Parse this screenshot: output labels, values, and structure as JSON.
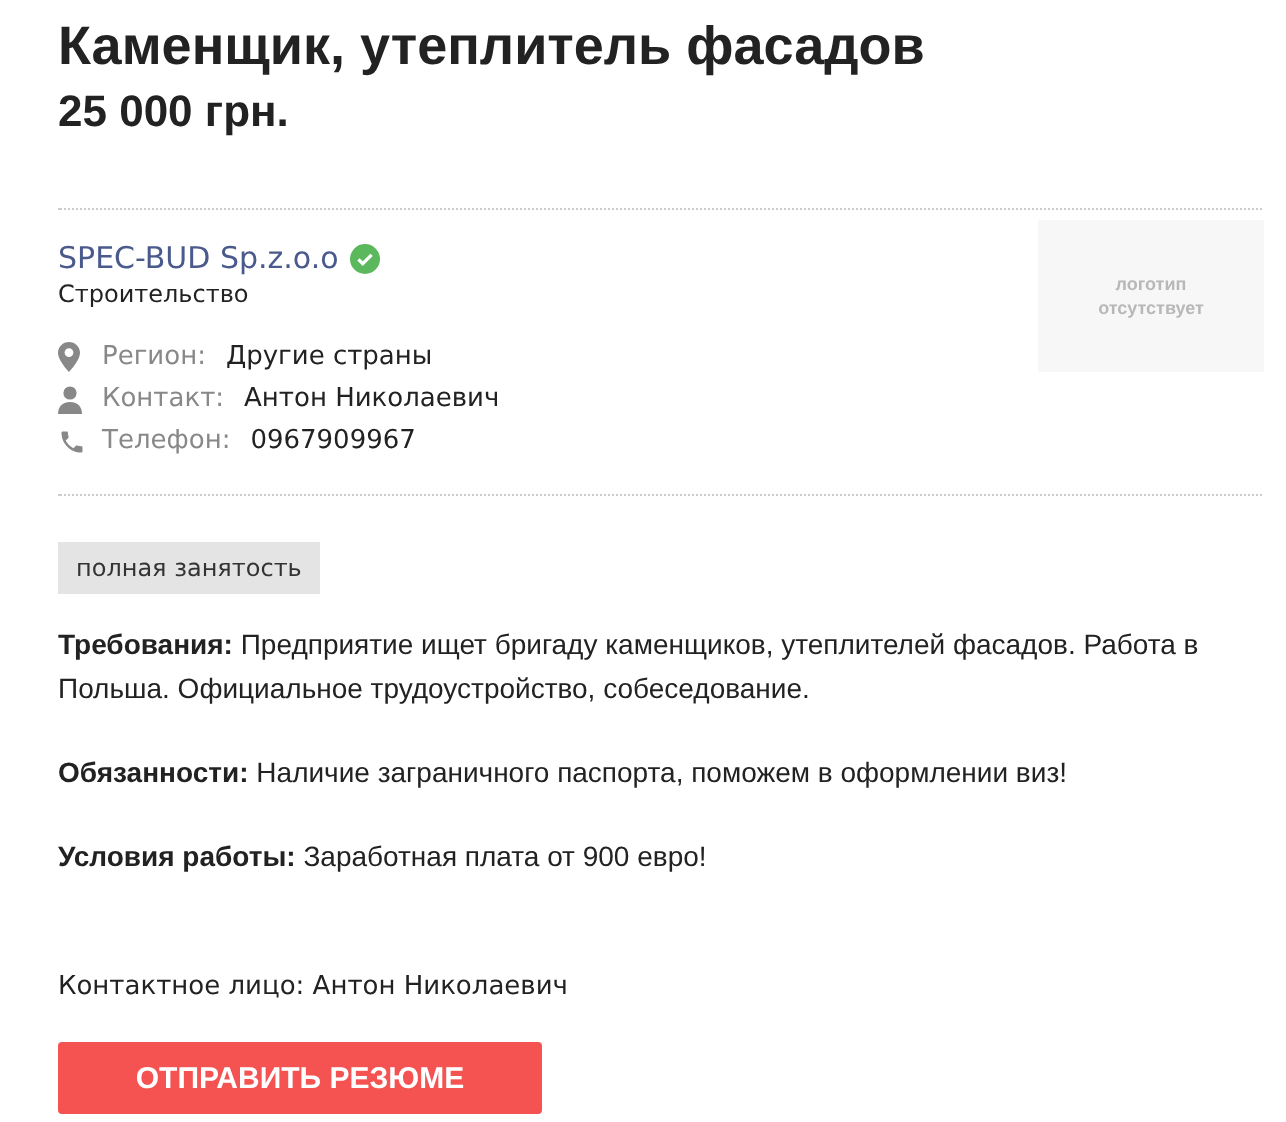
{
  "title": "Каменщик, утеплитель фасадов",
  "salary": "25 000 грн.",
  "company": {
    "name": "SPEC-BUD Sp.z.o.o",
    "verified": true,
    "sector": "Строительство",
    "logo_placeholder": [
      "логотип",
      "отсутствует"
    ]
  },
  "info": [
    {
      "kind": "location",
      "label": "Регион:",
      "value": "Другие страны"
    },
    {
      "kind": "person",
      "label": "Контакт:",
      "value": "Антон Николаевич"
    },
    {
      "kind": "phone",
      "label": "Телефон:",
      "value": "0967909967"
    }
  ],
  "tags": [
    "полная занятость"
  ],
  "paragraphs": [
    "**Требования:** Предприятие ищет бригаду каменщиков, утеплителей фасадов. Работа в Польша. Официальное трудоустройство, собеседование.",
    "**Обязанности:** Наличие заграничного паспорта, поможем в оформлении виз!",
    "**Условия работы:** Заработная плата от 900 евро!"
  ],
  "contact_person": "Контактное лицо: Антон Николаевич",
  "apply_button": "ОТПРАВИТЬ РЕЗЮМЕ"
}
